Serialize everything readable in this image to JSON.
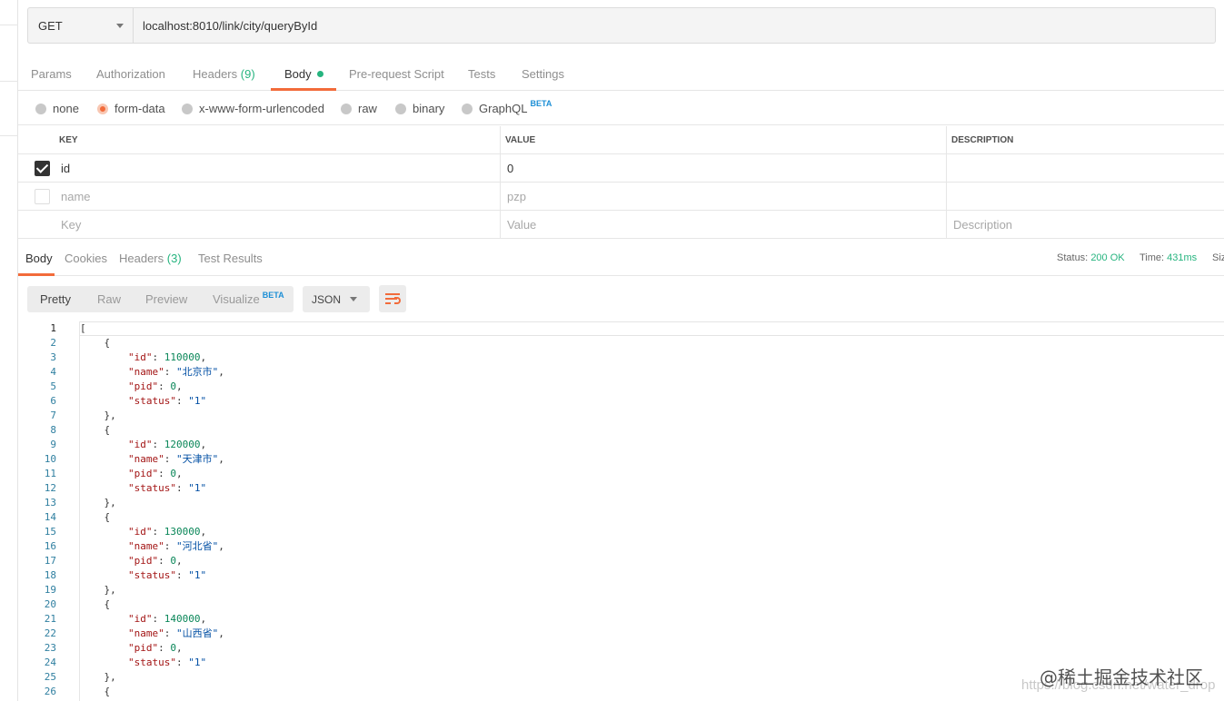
{
  "request": {
    "method": "GET",
    "url": "localhost:8010/link/city/queryById"
  },
  "request_tabs": [
    {
      "label": "Params"
    },
    {
      "label": "Authorization"
    },
    {
      "label": "Headers",
      "count": "(9)"
    },
    {
      "label": "Body"
    },
    {
      "label": "Pre-request Script"
    },
    {
      "label": "Tests"
    },
    {
      "label": "Settings"
    }
  ],
  "body_types": [
    {
      "label": "none"
    },
    {
      "label": "form-data"
    },
    {
      "label": "x-www-form-urlencoded"
    },
    {
      "label": "raw"
    },
    {
      "label": "binary"
    },
    {
      "label": "GraphQL",
      "badge": "BETA"
    }
  ],
  "params_table": {
    "headers": [
      "KEY",
      "VALUE",
      "DESCRIPTION"
    ],
    "rows": [
      {
        "key": "id",
        "value": "0",
        "description": ""
      },
      {
        "key": "name",
        "value": "pzp",
        "description": ""
      }
    ],
    "placeholders": {
      "key": "Key",
      "value": "Value",
      "description": "Description"
    }
  },
  "response_tabs": [
    {
      "label": "Body"
    },
    {
      "label": "Cookies"
    },
    {
      "label": "Headers",
      "count": "(3)"
    },
    {
      "label": "Test Results"
    }
  ],
  "response_status": {
    "status_label": "Status:",
    "status_value": "200 OK",
    "time_label": "Time:",
    "time_value": "431ms",
    "size_label": "Siz"
  },
  "view_modes": [
    {
      "label": "Pretty"
    },
    {
      "label": "Raw"
    },
    {
      "label": "Preview"
    },
    {
      "label": "Visualize",
      "badge": "BETA"
    }
  ],
  "format": "JSON",
  "code_lines": [
    {
      "n": "1",
      "parts": [
        [
          "p",
          "["
        ]
      ]
    },
    {
      "n": "2",
      "parts": [
        [
          "p",
          "    {"
        ]
      ]
    },
    {
      "n": "3",
      "parts": [
        [
          "p",
          "        "
        ],
        [
          "k",
          "\"id\""
        ],
        [
          "p",
          ": "
        ],
        [
          "n",
          "110000"
        ],
        [
          "p",
          ","
        ]
      ]
    },
    {
      "n": "4",
      "parts": [
        [
          "p",
          "        "
        ],
        [
          "k",
          "\"name\""
        ],
        [
          "p",
          ": "
        ],
        [
          "s",
          "\"北京市\""
        ],
        [
          "p",
          ","
        ]
      ]
    },
    {
      "n": "5",
      "parts": [
        [
          "p",
          "        "
        ],
        [
          "k",
          "\"pid\""
        ],
        [
          "p",
          ": "
        ],
        [
          "n",
          "0"
        ],
        [
          "p",
          ","
        ]
      ]
    },
    {
      "n": "6",
      "parts": [
        [
          "p",
          "        "
        ],
        [
          "k",
          "\"status\""
        ],
        [
          "p",
          ": "
        ],
        [
          "s",
          "\"1\""
        ]
      ]
    },
    {
      "n": "7",
      "parts": [
        [
          "p",
          "    },"
        ]
      ]
    },
    {
      "n": "8",
      "parts": [
        [
          "p",
          "    {"
        ]
      ]
    },
    {
      "n": "9",
      "parts": [
        [
          "p",
          "        "
        ],
        [
          "k",
          "\"id\""
        ],
        [
          "p",
          ": "
        ],
        [
          "n",
          "120000"
        ],
        [
          "p",
          ","
        ]
      ]
    },
    {
      "n": "10",
      "parts": [
        [
          "p",
          "        "
        ],
        [
          "k",
          "\"name\""
        ],
        [
          "p",
          ": "
        ],
        [
          "s",
          "\"天津市\""
        ],
        [
          "p",
          ","
        ]
      ]
    },
    {
      "n": "11",
      "parts": [
        [
          "p",
          "        "
        ],
        [
          "k",
          "\"pid\""
        ],
        [
          "p",
          ": "
        ],
        [
          "n",
          "0"
        ],
        [
          "p",
          ","
        ]
      ]
    },
    {
      "n": "12",
      "parts": [
        [
          "p",
          "        "
        ],
        [
          "k",
          "\"status\""
        ],
        [
          "p",
          ": "
        ],
        [
          "s",
          "\"1\""
        ]
      ]
    },
    {
      "n": "13",
      "parts": [
        [
          "p",
          "    },"
        ]
      ]
    },
    {
      "n": "14",
      "parts": [
        [
          "p",
          "    {"
        ]
      ]
    },
    {
      "n": "15",
      "parts": [
        [
          "p",
          "        "
        ],
        [
          "k",
          "\"id\""
        ],
        [
          "p",
          ": "
        ],
        [
          "n",
          "130000"
        ],
        [
          "p",
          ","
        ]
      ]
    },
    {
      "n": "16",
      "parts": [
        [
          "p",
          "        "
        ],
        [
          "k",
          "\"name\""
        ],
        [
          "p",
          ": "
        ],
        [
          "s",
          "\"河北省\""
        ],
        [
          "p",
          ","
        ]
      ]
    },
    {
      "n": "17",
      "parts": [
        [
          "p",
          "        "
        ],
        [
          "k",
          "\"pid\""
        ],
        [
          "p",
          ": "
        ],
        [
          "n",
          "0"
        ],
        [
          "p",
          ","
        ]
      ]
    },
    {
      "n": "18",
      "parts": [
        [
          "p",
          "        "
        ],
        [
          "k",
          "\"status\""
        ],
        [
          "p",
          ": "
        ],
        [
          "s",
          "\"1\""
        ]
      ]
    },
    {
      "n": "19",
      "parts": [
        [
          "p",
          "    },"
        ]
      ]
    },
    {
      "n": "20",
      "parts": [
        [
          "p",
          "    {"
        ]
      ]
    },
    {
      "n": "21",
      "parts": [
        [
          "p",
          "        "
        ],
        [
          "k",
          "\"id\""
        ],
        [
          "p",
          ": "
        ],
        [
          "n",
          "140000"
        ],
        [
          "p",
          ","
        ]
      ]
    },
    {
      "n": "22",
      "parts": [
        [
          "p",
          "        "
        ],
        [
          "k",
          "\"name\""
        ],
        [
          "p",
          ": "
        ],
        [
          "s",
          "\"山西省\""
        ],
        [
          "p",
          ","
        ]
      ]
    },
    {
      "n": "23",
      "parts": [
        [
          "p",
          "        "
        ],
        [
          "k",
          "\"pid\""
        ],
        [
          "p",
          ": "
        ],
        [
          "n",
          "0"
        ],
        [
          "p",
          ","
        ]
      ]
    },
    {
      "n": "24",
      "parts": [
        [
          "p",
          "        "
        ],
        [
          "k",
          "\"status\""
        ],
        [
          "p",
          ": "
        ],
        [
          "s",
          "\"1\""
        ]
      ]
    },
    {
      "n": "25",
      "parts": [
        [
          "p",
          "    },"
        ]
      ]
    },
    {
      "n": "26",
      "parts": [
        [
          "p",
          "    {"
        ]
      ]
    }
  ],
  "watermark": {
    "text": "@稀土掘金技术社区",
    "url_text": "https://blog.csdn.net/water_drop"
  },
  "colors": {
    "accent": "#f26b3a",
    "success": "#26b47f",
    "beta": "#1d8fd6"
  }
}
